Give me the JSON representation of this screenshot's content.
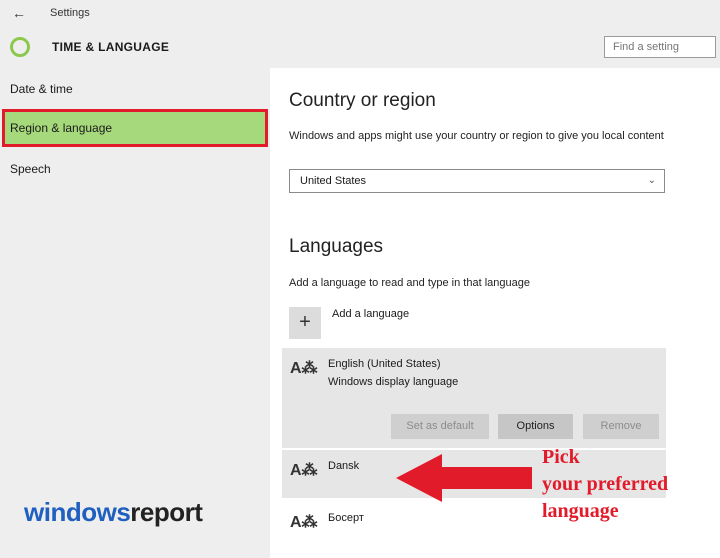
{
  "titlebar": {
    "back_icon": "back-arrow-icon",
    "title": "Settings"
  },
  "header": {
    "title": "TIME & LANGUAGE",
    "search_placeholder": "Find a setting"
  },
  "sidebar": {
    "items": [
      {
        "label": "Date & time",
        "selected": false
      },
      {
        "label": "Region & language",
        "selected": true
      },
      {
        "label": "Speech",
        "selected": false
      }
    ]
  },
  "country": {
    "heading": "Country or region",
    "description": "Windows and apps might use your country or region to give you local content",
    "selected": "United States"
  },
  "languages": {
    "heading": "Languages",
    "description": "Add a language to read and type in that language",
    "add_label": "Add a language",
    "items": [
      {
        "name": "English (United States)",
        "sub": "Windows display language"
      },
      {
        "name": "Dansk",
        "sub": ""
      },
      {
        "name": "Босерт",
        "sub": ""
      }
    ],
    "buttons": {
      "set_default": "Set as default",
      "options": "Options",
      "remove": "Remove"
    }
  },
  "annotation": {
    "line1": "Pick",
    "line2": "your preferred",
    "line3": "language",
    "color": "#e21b2a"
  },
  "watermark": {
    "part1": "windows",
    "part2": "report"
  },
  "colors": {
    "selection": "#a6d97b",
    "highlight_border": "#e21b2a",
    "sidebar_bg": "#eeeeee"
  }
}
